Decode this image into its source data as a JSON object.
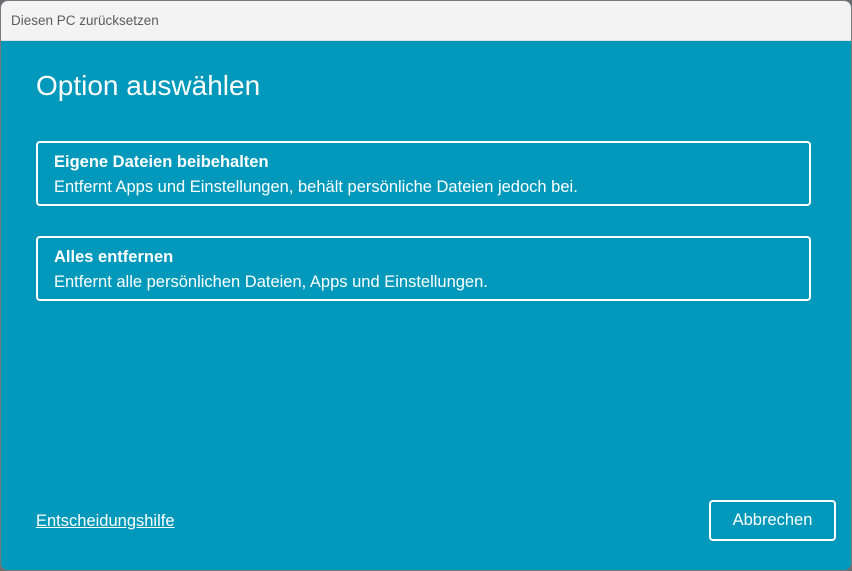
{
  "window": {
    "title": "Diesen PC zurücksetzen"
  },
  "main": {
    "heading": "Option auswählen",
    "options": [
      {
        "title": "Eigene Dateien beibehalten",
        "description": "Entfernt Apps und Einstellungen, behält persönliche Dateien jedoch bei."
      },
      {
        "title": "Alles entfernen",
        "description": "Entfernt alle persönlichen Dateien, Apps und Einstellungen."
      }
    ]
  },
  "footer": {
    "help_link": "Entscheidungshilfe",
    "cancel_label": "Abbrechen"
  },
  "colors": {
    "accent_background": "#0099bc",
    "titlebar_background": "#f3f3f3",
    "foreground": "#ffffff"
  }
}
